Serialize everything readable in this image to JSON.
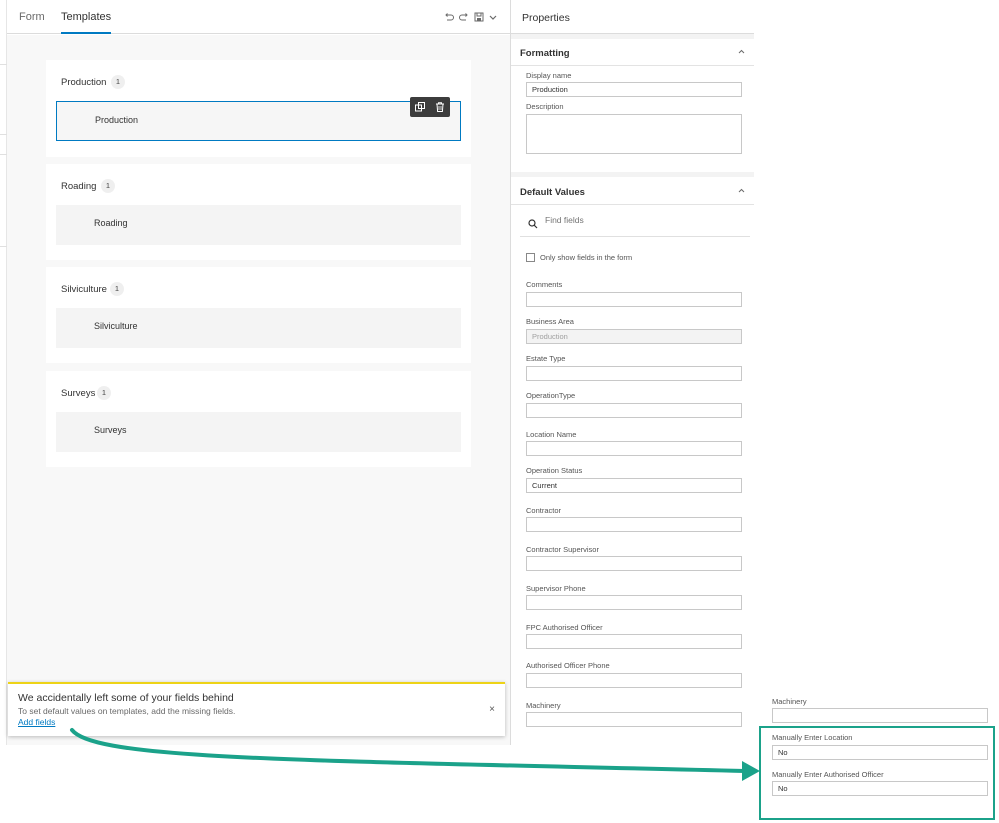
{
  "tabs": [
    {
      "label": "Form",
      "active": false
    },
    {
      "label": "Templates",
      "active": true
    }
  ],
  "toolbar_icons": [
    "undo-icon",
    "redo-icon",
    "save-icon",
    "chevron-down-icon"
  ],
  "templates": [
    {
      "title": "Production",
      "count": "1",
      "tile": "Production",
      "selected": true
    },
    {
      "title": "Roading",
      "count": "1",
      "tile": "Roading",
      "selected": false
    },
    {
      "title": "Silviculture",
      "count": "1",
      "tile": "Silviculture",
      "selected": false
    },
    {
      "title": "Surveys",
      "count": "1",
      "tile": "Surveys",
      "selected": false
    }
  ],
  "notice": {
    "title": "We accidentally left some of your fields behind",
    "message": "To set default values on templates, add the missing fields.",
    "link": "Add fields",
    "close": "×"
  },
  "properties": {
    "title": "Properties",
    "formatting": {
      "title": "Formatting",
      "display_name_label": "Display name",
      "display_name_value": "Production",
      "description_label": "Description"
    },
    "defaults": {
      "title": "Default Values",
      "search_placeholder": "Find fields",
      "only_show_label": "Only show fields in the form",
      "fields": [
        {
          "label": "Comments",
          "value": "",
          "disabled": false
        },
        {
          "label": "Business Area",
          "value": "Production",
          "disabled": true
        },
        {
          "label": "Estate Type",
          "value": "",
          "disabled": false
        },
        {
          "label": "OperationType",
          "value": "",
          "disabled": false
        },
        {
          "label": "Location Name",
          "value": "",
          "disabled": false
        },
        {
          "label": "Operation Status",
          "value": "Current",
          "disabled": false
        },
        {
          "label": "Contractor",
          "value": "",
          "disabled": false
        },
        {
          "label": "Contractor Supervisor",
          "value": "",
          "disabled": false
        },
        {
          "label": "Supervisor Phone",
          "value": "",
          "disabled": false
        },
        {
          "label": "FPC Authorised Officer",
          "value": "",
          "disabled": false
        },
        {
          "label": "Authorised Officer Phone",
          "value": "",
          "disabled": false
        },
        {
          "label": "Machinery",
          "value": "",
          "disabled": false
        }
      ]
    }
  },
  "callout": {
    "fields": [
      {
        "label": "Machinery",
        "value": ""
      },
      {
        "label": "Manually Enter Location",
        "value": "No"
      },
      {
        "label": "Manually Enter Authorised Officer",
        "value": "No"
      }
    ]
  },
  "colors": {
    "accent": "#007ac2",
    "highlight": "#1ba28a",
    "warning": "#edd317"
  }
}
